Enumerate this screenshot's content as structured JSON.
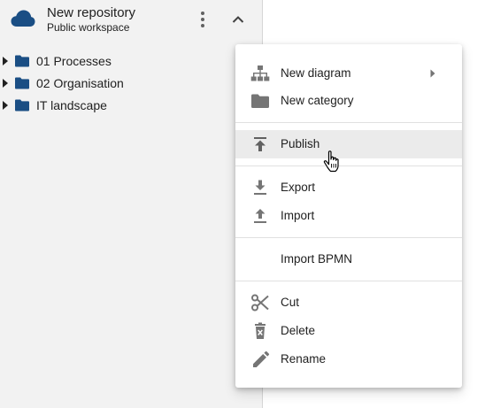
{
  "repository": {
    "title": "New repository",
    "subtitle": "Public workspace",
    "icon": "cloud-icon"
  },
  "tree": {
    "items": [
      {
        "label": "01 Processes",
        "icon": "folder-icon"
      },
      {
        "label": "02 Organisation",
        "icon": "folder-icon"
      },
      {
        "label": "IT landscape",
        "icon": "folder-icon"
      }
    ]
  },
  "context_menu": {
    "items": {
      "new_diagram": {
        "label": "New diagram",
        "icon": "hierarchy-icon",
        "has_submenu": true
      },
      "new_category": {
        "label": "New category",
        "icon": "folder-icon"
      },
      "publish": {
        "label": "Publish",
        "icon": "publish-icon",
        "state": "hovered"
      },
      "export": {
        "label": "Export",
        "icon": "download-icon"
      },
      "import": {
        "label": "Import",
        "icon": "upload-icon"
      },
      "import_bpmn": {
        "label": "Import BPMN"
      },
      "cut": {
        "label": "Cut",
        "icon": "scissors-icon"
      },
      "delete": {
        "label": "Delete",
        "icon": "trash-icon"
      },
      "rename": {
        "label": "Rename",
        "icon": "pencil-icon"
      }
    }
  },
  "colors": {
    "accent": "#1a4e84",
    "sidebar_bg": "#f2f2f2",
    "icon_gray": "#757575",
    "hover_bg": "#ebebeb"
  }
}
